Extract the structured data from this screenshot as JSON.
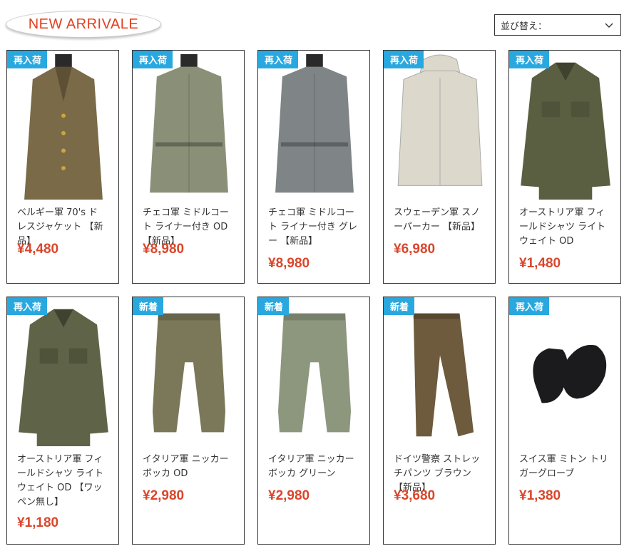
{
  "header": {
    "new_arrival": "NEW ARRIVALE"
  },
  "sort": {
    "label": "並び替え："
  },
  "colors": {
    "tag": "#29a8e0",
    "price": "#d9462b",
    "badge_text": "#e2401f"
  },
  "products": [
    {
      "tag": "再入荷",
      "name": "ベルギー軍 70's ドレスジャケット 【新品】",
      "price": "¥4,480",
      "icon": "jacket-icon",
      "color": "#7a6a48"
    },
    {
      "tag": "再入荷",
      "name": "チェコ軍 ミドルコート ライナー付き OD 【新品】",
      "price": "¥8,980",
      "icon": "coat-icon",
      "color": "#8a9077"
    },
    {
      "tag": "再入荷",
      "name": "チェコ軍 ミドルコート ライナー付き グレー 【新品】",
      "price": "¥8,980",
      "icon": "coat-icon",
      "color": "#7f8587"
    },
    {
      "tag": "再入荷",
      "name": "スウェーデン軍 スノーパーカー 【新品】",
      "price": "¥6,980",
      "icon": "parka-icon",
      "color": "#ddd8cc"
    },
    {
      "tag": "再入荷",
      "name": "オーストリア軍 フィールドシャツ ライトウェイト OD",
      "price": "¥1,480",
      "icon": "shirt-icon",
      "color": "#5b5f42"
    },
    {
      "tag": "再入荷",
      "name": "オーストリア軍 フィールドシャツ ライトウェイト OD 【ワッペン無し】",
      "price": "¥1,180",
      "icon": "shirt-icon",
      "color": "#5f6448"
    },
    {
      "tag": "新着",
      "name": "イタリア軍 ニッカーボッカ OD",
      "price": "¥2,980",
      "icon": "knickers-icon",
      "color": "#7a7858"
    },
    {
      "tag": "新着",
      "name": "イタリア軍 ニッカーボッカ グリーン",
      "price": "¥2,980",
      "icon": "knickers-icon",
      "color": "#8c977e"
    },
    {
      "tag": "新着",
      "name": "ドイツ警察 ストレッチパンツ ブラウン 【新品】",
      "price": "¥3,680",
      "icon": "pants-icon",
      "color": "#6e5a3c"
    },
    {
      "tag": "再入荷",
      "name": "スイス軍 ミトン トリガーグローブ",
      "price": "¥1,380",
      "icon": "mitten-icon",
      "color": "#1b1b1d"
    }
  ]
}
